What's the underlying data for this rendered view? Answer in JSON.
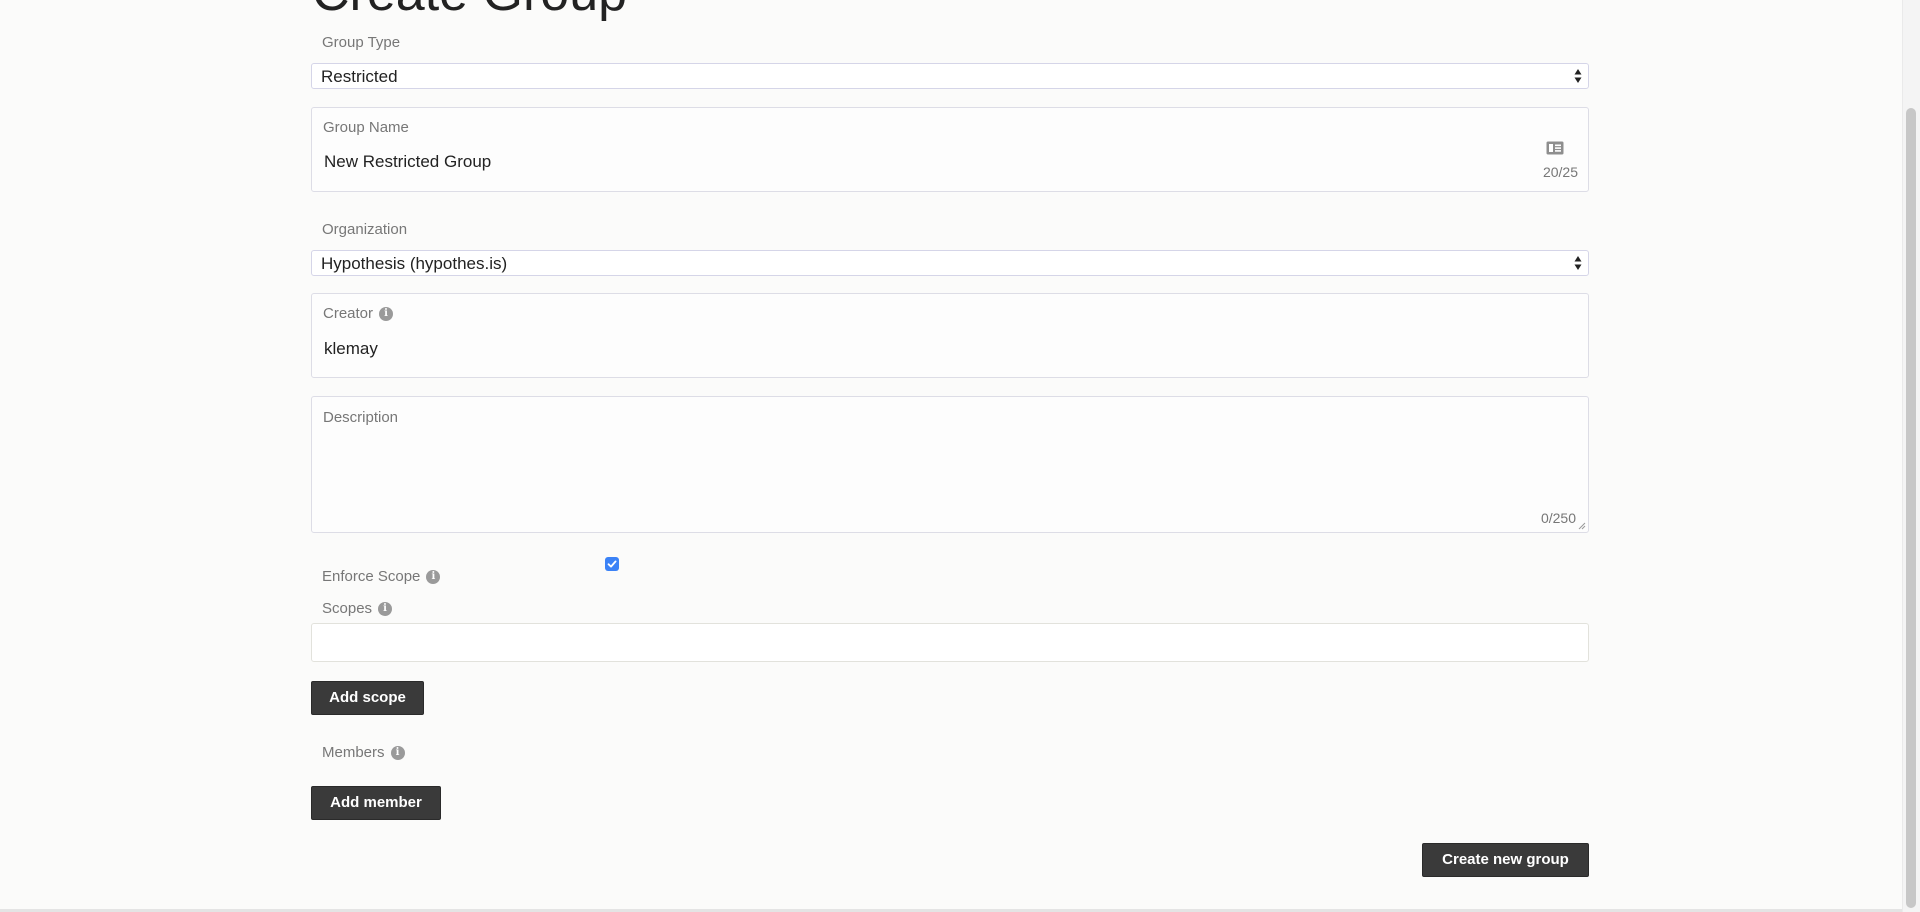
{
  "page": {
    "title": "Create Group"
  },
  "form": {
    "group_type": {
      "label": "Group Type",
      "value": "Restricted"
    },
    "group_name": {
      "label": "Group Name",
      "value": "New Restricted Group",
      "counter": "20/25"
    },
    "organization": {
      "label": "Organization",
      "value": "Hypothesis (hypothes.is)"
    },
    "creator": {
      "label": "Creator",
      "value": "klemay"
    },
    "description": {
      "label": "Description",
      "value": "",
      "counter": "0/250"
    },
    "enforce_scope": {
      "label": "Enforce Scope",
      "checked": true
    },
    "scopes": {
      "label": "Scopes",
      "value": ""
    },
    "members": {
      "label": "Members"
    }
  },
  "buttons": {
    "add_scope": "Add scope",
    "add_member": "Add member",
    "create_group": "Create new group"
  },
  "icons": {
    "info": "info-icon",
    "contact_card": "contact-card-icon",
    "checkmark": "checkmark-icon"
  },
  "colors": {
    "background": "#fbfbfa",
    "button": "#3a3a3a",
    "checkbox": "#3b82f6"
  }
}
